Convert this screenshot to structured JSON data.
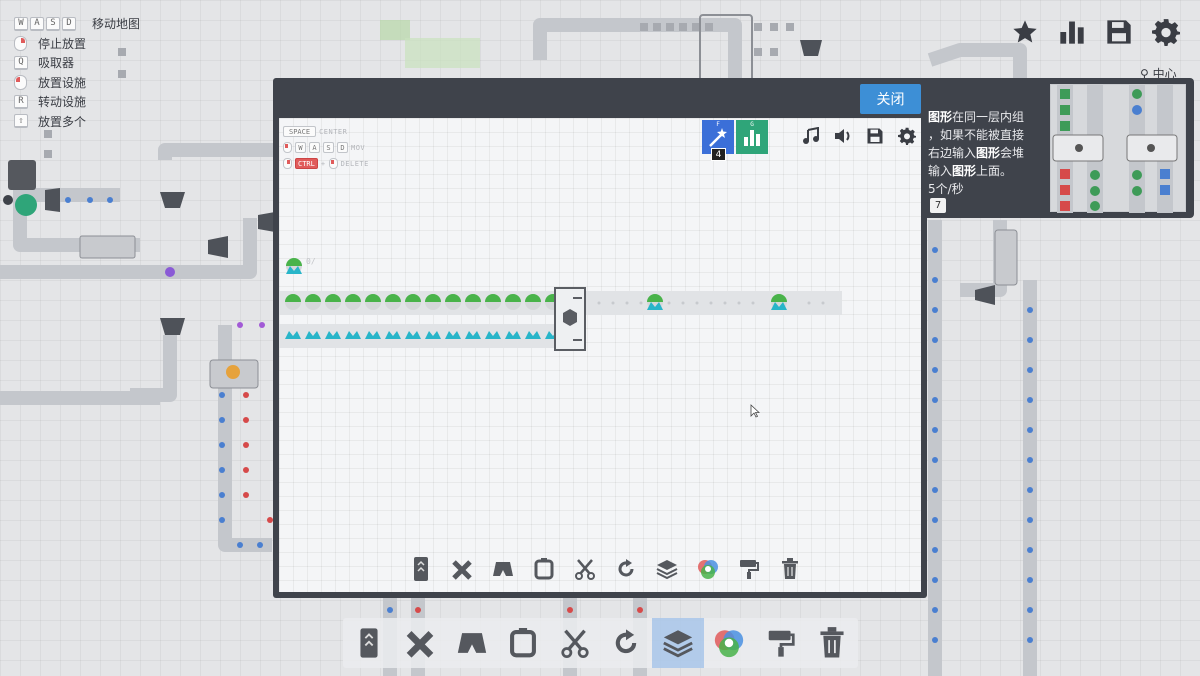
{
  "hotkeys": [
    {
      "keys": [
        "W",
        "A",
        "S",
        "D"
      ],
      "label": "移动地图",
      "mouse": false
    },
    {
      "keys": [],
      "label": "停止放置",
      "mouse": true,
      "mouse_side": "right"
    },
    {
      "keys": [
        "Q"
      ],
      "label": "吸取器",
      "mouse": false
    },
    {
      "keys": [],
      "label": "放置设施",
      "mouse": true,
      "mouse_side": "left"
    },
    {
      "keys": [
        "R"
      ],
      "label": "转动设施",
      "mouse": false
    },
    {
      "keys": [
        "⇧"
      ],
      "label": "放置多个",
      "mouse": false
    }
  ],
  "top_right_icons": [
    "star-icon",
    "stats-icon",
    "save-icon",
    "settings-icon"
  ],
  "location_label": "中心",
  "tutorial": {
    "text_parts": [
      {
        "text": "图形",
        "bold": true
      },
      {
        "text": "在同一层内组",
        "bold": false
      },
      {
        "text": "，如果不能被直接",
        "bold": false
      },
      {
        "text": "右边输入",
        "bold": false
      },
      {
        "text": "图形",
        "bold": true
      },
      {
        "text": "会堆",
        "bold": false
      },
      {
        "text": "输入",
        "bold": false
      },
      {
        "text": "图形",
        "bold": true
      },
      {
        "text": "上面。",
        "bold": false
      }
    ],
    "rate": "5个/秒",
    "key_hint": "7"
  },
  "dialog": {
    "close_label": "关闭",
    "inner_hotkeys": [
      {
        "keys": [
          "SPACE"
        ],
        "label": "CENTER"
      },
      {
        "keys": [
          "W",
          "A",
          "S",
          "D"
        ],
        "label": "MOV"
      },
      {
        "keys": [
          "CTRL",
          "+"
        ],
        "label": "DELETE"
      }
    ],
    "upgrade_key": "F",
    "upgrade_count": "4",
    "stats_key": "G",
    "top_icons": [
      "music-icon",
      "sound-icon",
      "save-icon",
      "settings-icon"
    ],
    "toolbar": [
      "belt-icon",
      "balancer-icon",
      "tunnel-icon",
      "rotater-icon",
      "cutter-icon",
      "rotate-icon",
      "stacker-icon",
      "mixer-icon",
      "painter-icon",
      "trash-icon"
    ]
  },
  "toolbar": {
    "tools": [
      "belt-icon",
      "balancer-icon",
      "tunnel-icon",
      "rotater-icon",
      "cutter-icon",
      "rotate-icon",
      "stacker-icon",
      "mixer-icon",
      "painter-icon",
      "trash-icon"
    ],
    "active_tool": "stacker-icon"
  }
}
